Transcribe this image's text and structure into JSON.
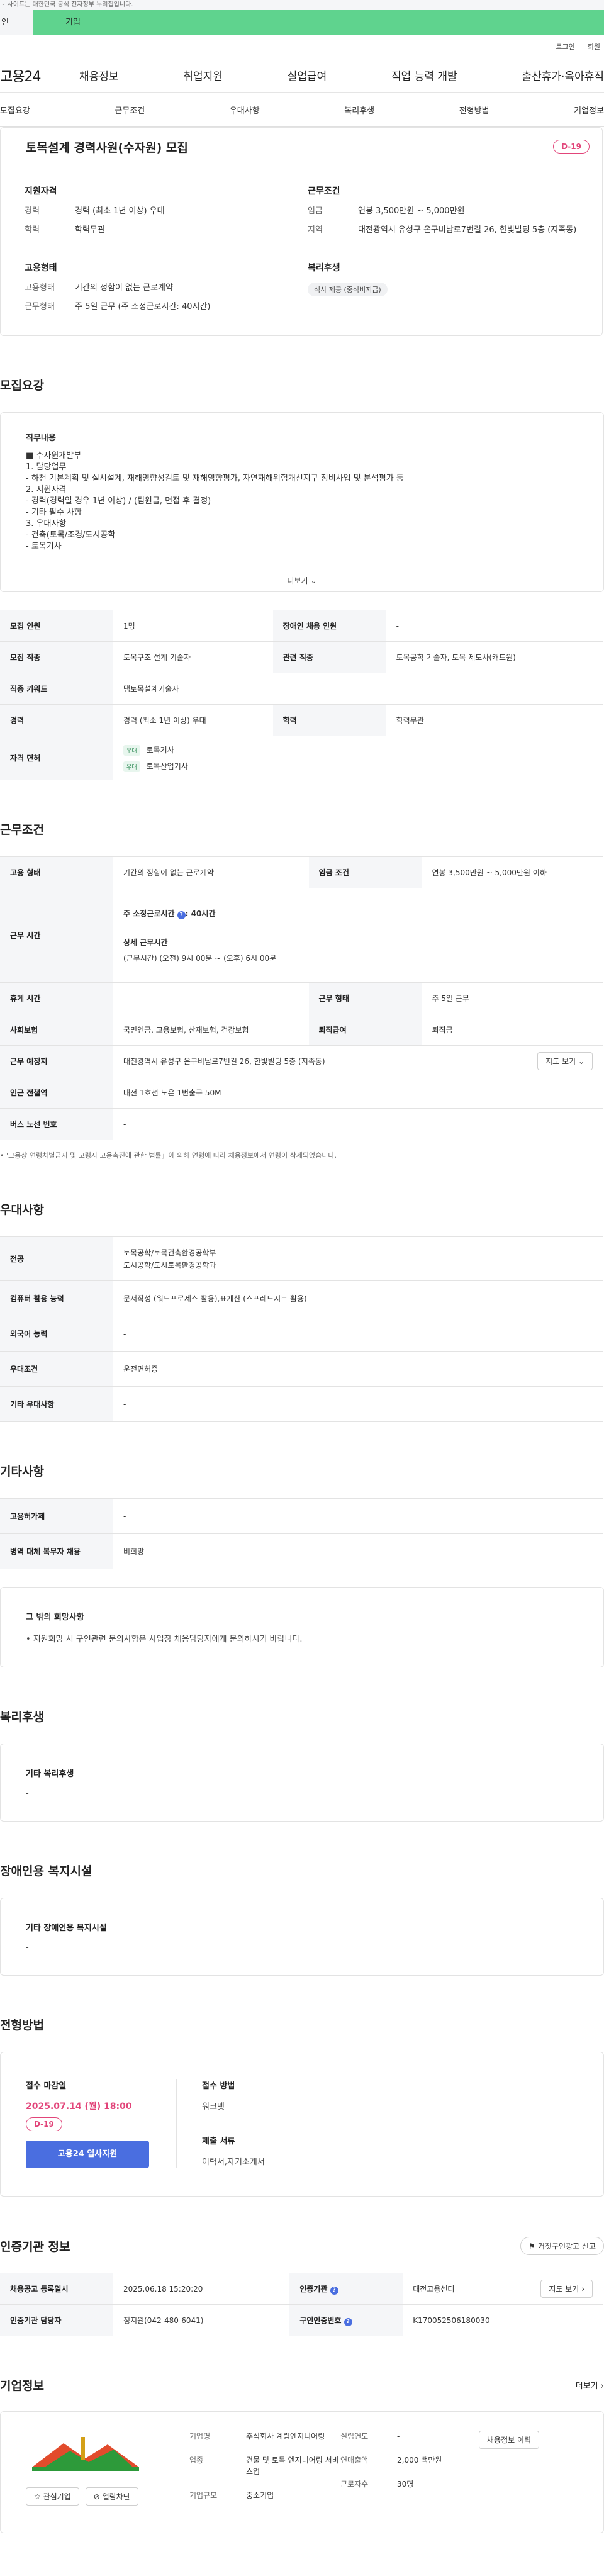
{
  "topbar": {
    "notice": "~ 사이트는 대한민국 공식 전자정부 누리집입니다."
  },
  "tabs": {
    "individual": "인",
    "business": "기업"
  },
  "util": {
    "login": "로그인",
    "signup": "회원"
  },
  "gnb": {
    "logo": "고용24",
    "items": [
      "채용정보",
      "취업지원",
      "실업급여",
      "직업 능력 개발",
      "출산휴가·육아휴직"
    ]
  },
  "anchor": [
    "모집요강",
    "근무조건",
    "우대사항",
    "복리후생",
    "전형방법",
    "기업정보"
  ],
  "summary": {
    "title": "토목설계 경력사원(수자원) 모집",
    "dday": "D-19",
    "qual_title": "지원자격",
    "qual": [
      {
        "k": "경력",
        "v": "경력 (최소 1년 이상) 우대"
      },
      {
        "k": "학력",
        "v": "학력무관"
      }
    ],
    "emp_title": "고용형태",
    "emp": [
      {
        "k": "고용형태",
        "v": "기간의 정함이 없는 근로계약"
      },
      {
        "k": "근무형태",
        "v": "주 5일 근무 (주 소정근로시간: 40시간)"
      }
    ],
    "cond_title": "근무조건",
    "cond": [
      {
        "k": "임금",
        "v": "연봉 3,500만원 ~ 5,000만원"
      },
      {
        "k": "지역",
        "v": "대전광역시 유성구 온구비남로7번길 26, 한빛빌딩 5층 (지족동)"
      }
    ],
    "welfare_title": "복리후생",
    "welfare_tag": "식사 제공 (중식비지급)"
  },
  "recruit": {
    "title": "모집요강",
    "duty_head": "직무내용",
    "duty_lines": [
      "■ 수자원개발부",
      "1. 담당업무",
      " - 하천 기본계획 및 실시설계, 재해영향성검토 및 재해영향평가, 자연재해위험개선지구 정비사업 및 분석평가 등",
      "2. 지원자격",
      " - 경력(경력일 경우 1년 이상) / (팀원급, 면접 후 결정)",
      " - 기타 필수 사항",
      "3. 우대사항",
      " - 건축(토목/조경/도시공학",
      " - 토목기사"
    ],
    "more": "더보기",
    "rows": [
      [
        {
          "k": "모집 인원",
          "v": "1명"
        },
        {
          "k": "장애인 채용 인원",
          "v": "-"
        }
      ],
      [
        {
          "k": "모집 직종",
          "v": "토목구조 설계 기술자"
        },
        {
          "k": "관련 직종",
          "v": "토목공학 기술자, 토목 제도사(캐드원)"
        }
      ],
      [
        {
          "k": "직종 키워드",
          "v": "댐토목설계기술자"
        }
      ],
      [
        {
          "k": "경력",
          "v": "경력 (최소 1년 이상) 우대"
        },
        {
          "k": "학력",
          "v": "학력무관"
        }
      ]
    ],
    "license_label": "자격 면허",
    "license_badge": "우대",
    "licenses": [
      "토목기사",
      "토목산업기사"
    ]
  },
  "work": {
    "title": "근무조건",
    "type_k": "고용 형태",
    "type_v": "기간의 정함이 없는 근로계약",
    "wage_k": "임금 조건",
    "wage_v": "연봉 3,500만원 ~ 5,000만원 이하",
    "hours_k": "근무 시간",
    "hours_main": "주 소정근로시간",
    "hours_val": ": 40시간",
    "hours_detail_h": "상세 근무시간",
    "hours_detail": "(근무시간) (오전) 9시 00분 ~ (오후) 6시 00분",
    "rest_k": "휴게 시간",
    "rest_v": "-",
    "form_k": "근무 형태",
    "form_v": "주 5일 근무",
    "ins_k": "사회보험",
    "ins_v": "국민연금, 고용보험, 산재보험, 건강보험",
    "ret_k": "퇴직급여",
    "ret_v": "퇴직금",
    "place_k": "근무 예정지",
    "place_v": "대전광역시 유성구 온구비남로7번길 26, 한빛빌딩 5층 (지족동)",
    "map_btn": "지도 보기",
    "sub_k": "인근 전철역",
    "sub_v": "대전 1호선 노은 1번출구 50M",
    "bus_k": "버스 노선 번호",
    "bus_v": "-",
    "note": "• '고용상 연령차별금지 및 고령자 고용촉진에 관한 법률」에 의해 연령에 따라 채용정보에서 연령이 삭제되었습니다."
  },
  "pref": {
    "title": "우대사항",
    "major_k": "전공",
    "major_v1": "토목공학/토목건축환경공학부",
    "major_v2": "도시공학/도시토목환경공학과",
    "comp_k": "컴퓨터 활용 능력",
    "comp_v": "문서작성 (워드프로세스 활용),표계산 (스프레드시트 활용)",
    "lang_k": "외국어 능력",
    "lang_v": "-",
    "cond_k": "우대조건",
    "cond_v": "운전면허증",
    "etc_k": "기타 우대사항",
    "etc_v": "-"
  },
  "other": {
    "title": "기타사항",
    "plan_k": "고용허가제",
    "plan_v": "-",
    "mil_k": "병역 대체 복무자 채용",
    "mil_v": "비희망",
    "box_h": "그 밖의 희망사항",
    "box_b": "• 지원희망 시 구인관련 문의사항은 사업장 채용담당자에게 문의하시기 바랍니다."
  },
  "welfare": {
    "title": "복리후생",
    "h": "기타 복리후생",
    "b": "-"
  },
  "disabled": {
    "title": "장애인용 복지시설",
    "h": "기타 장애인용 복지시설",
    "b": "-"
  },
  "process": {
    "title": "전형방법",
    "deadline_h": "접수 마감일",
    "deadline": "2025.07.14 (월) 18:00",
    "dday": "D-19",
    "apply": "고용24 입사지원",
    "method_h": "접수 방법",
    "method": "워크넷",
    "docs_h": "제출 서류",
    "docs": "이력서,자기소개서"
  },
  "cert": {
    "title": "인증기관 정보",
    "report_btn": "거짓구인광고 신고",
    "reg_k": "채용공고 등록일시",
    "reg_v": "2025.06.18 15:20:20",
    "org_k": "인증기관",
    "org_v": "대전고용센터",
    "map_btn": "지도 보기",
    "mgr_k": "인증기관 담당자",
    "mgr_v": "정지원(042-480-6041)",
    "id_k": "구인인증번호",
    "id_v": "K170052506180030"
  },
  "corp": {
    "title": "기업정보",
    "more": "더보기",
    "fav": "관심기업",
    "block": "열람차단",
    "list_btn": "채용정보 이력",
    "items_a": [
      {
        "k": "기업명",
        "v": "주식회사 계림엔지니어링"
      },
      {
        "k": "업종",
        "v": "건물 및 토목 엔지니어링 서비스업"
      },
      {
        "k": "기업규모",
        "v": "중소기업"
      }
    ],
    "items_b": [
      {
        "k": "설립연도",
        "v": "-"
      },
      {
        "k": "연매출액",
        "v": "2,000 백만원"
      },
      {
        "k": "근로자수",
        "v": "30명"
      }
    ]
  }
}
